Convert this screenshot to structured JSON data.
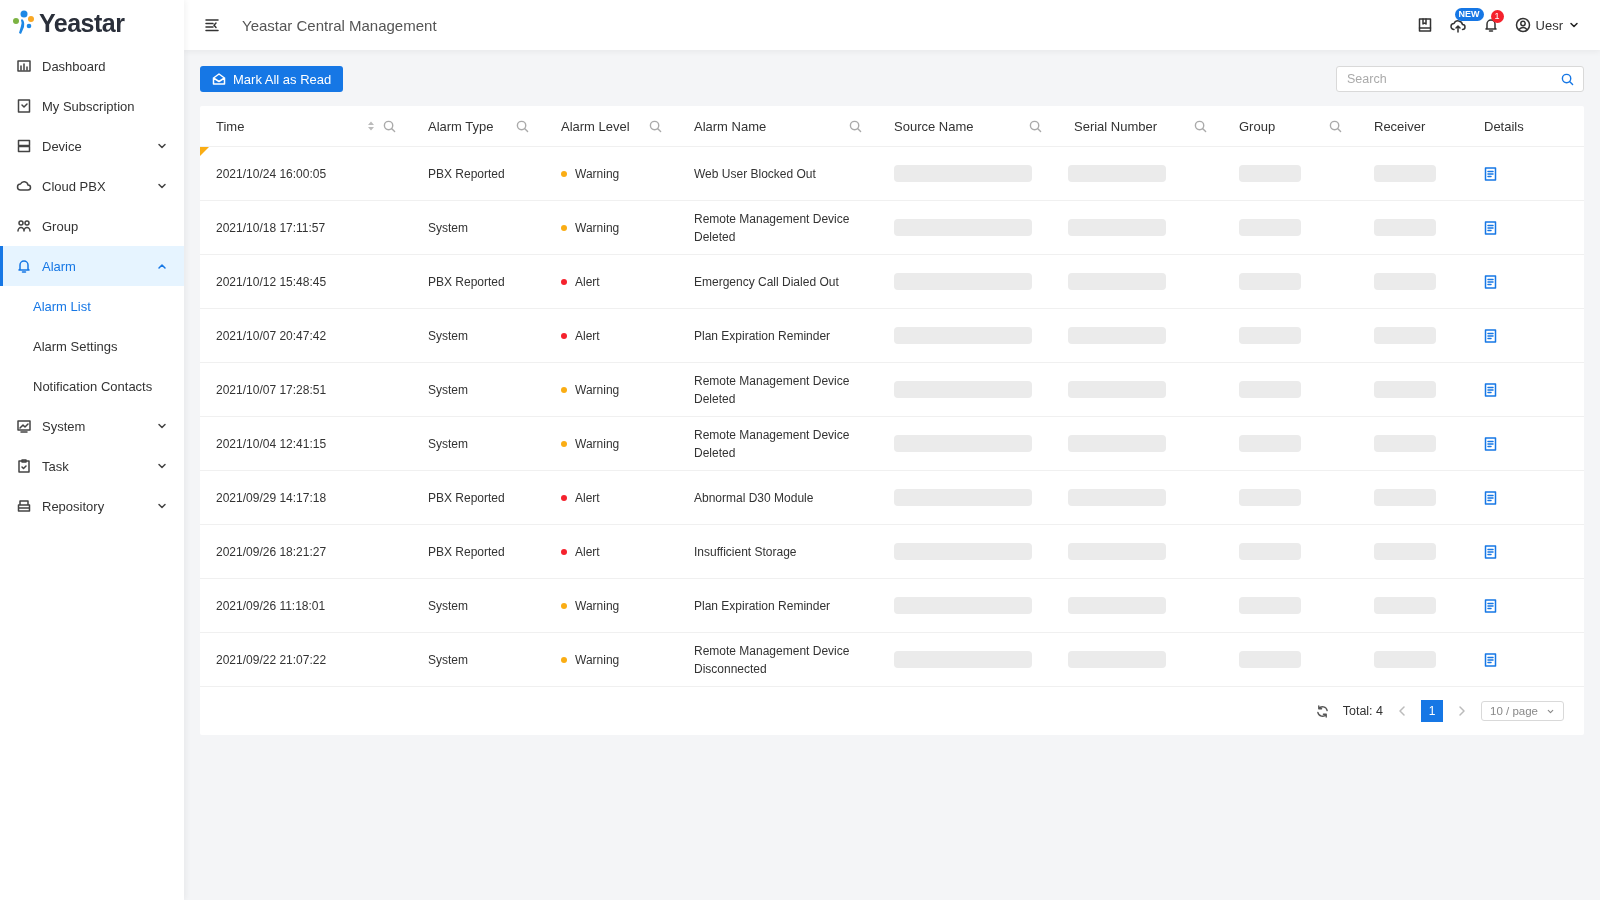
{
  "logo": {
    "text": "Yeastar"
  },
  "sidebar": {
    "items": [
      {
        "label": "Dashboard",
        "selected": false
      },
      {
        "label": "My Subscription",
        "selected": false
      },
      {
        "label": "Device",
        "selected": false,
        "expanded": false
      },
      {
        "label": "Cloud PBX",
        "selected": false,
        "expanded": false
      },
      {
        "label": "Group",
        "selected": false
      },
      {
        "label": "Alarm",
        "selected": true,
        "expanded": true,
        "children": [
          {
            "label": "Alarm List",
            "selected": true
          },
          {
            "label": "Alarm Settings",
            "selected": false
          },
          {
            "label": "Notification Contacts",
            "selected": false
          }
        ]
      },
      {
        "label": "System",
        "selected": false,
        "expanded": false
      },
      {
        "label": "Task",
        "selected": false,
        "expanded": false
      },
      {
        "label": "Repository",
        "selected": false,
        "expanded": false
      }
    ]
  },
  "header": {
    "title": "Yeastar Central Management",
    "update_badge": "NEW",
    "notification_count": "1",
    "user": "Uesr"
  },
  "toolbar": {
    "button": "Mark All as Read",
    "search": {
      "placeholder": "Search"
    }
  },
  "table": {
    "columns": [
      {
        "label": "Time",
        "sortable": true,
        "searchable": true
      },
      {
        "label": "Alarm Type",
        "sortable": false,
        "searchable": true
      },
      {
        "label": "Alarm Level",
        "sortable": false,
        "searchable": true
      },
      {
        "label": "Alarm Name",
        "sortable": false,
        "searchable": true
      },
      {
        "label": "Source Name",
        "sortable": false,
        "searchable": true
      },
      {
        "label": "Serial Number",
        "sortable": false,
        "searchable": true
      },
      {
        "label": "Group",
        "sortable": false,
        "searchable": true
      },
      {
        "label": "Receiver",
        "sortable": false,
        "searchable": false
      },
      {
        "label": "Details",
        "sortable": false,
        "searchable": false
      }
    ],
    "rows": [
      {
        "time": "2021/10/24 16:00:05",
        "type": "PBX Reported",
        "level": "Warning",
        "color": "#faad14",
        "name": "Web User Blocked Out",
        "unread": true
      },
      {
        "time": "2021/10/18 17:11:57",
        "type": "System",
        "level": "Warning",
        "color": "#faad14",
        "name": "Remote Management Device Deleted",
        "unread": false
      },
      {
        "time": "2021/10/12 15:48:45",
        "type": "PBX Reported",
        "level": "Alert",
        "color": "#f5222d",
        "name": "Emergency Call Dialed Out",
        "unread": false
      },
      {
        "time": "2021/10/07 20:47:42",
        "type": "System",
        "level": "Alert",
        "color": "#f5222d",
        "name": "Plan Expiration Reminder",
        "unread": false
      },
      {
        "time": "2021/10/07 17:28:51",
        "type": "System",
        "level": "Warning",
        "color": "#faad14",
        "name": "Remote Management Device Deleted",
        "unread": false
      },
      {
        "time": "2021/10/04 12:41:15",
        "type": "System",
        "level": "Warning",
        "color": "#faad14",
        "name": "Remote Management Device Deleted",
        "unread": false
      },
      {
        "time": "2021/09/29 14:17:18",
        "type": "PBX Reported",
        "level": "Alert",
        "color": "#f5222d",
        "name": "Abnormal D30 Module",
        "unread": false
      },
      {
        "time": "2021/09/26 18:21:27",
        "type": "PBX Reported",
        "level": "Alert",
        "color": "#f5222d",
        "name": "Insufficient Storage",
        "unread": false
      },
      {
        "time": "2021/09/26 11:18:01",
        "type": "System",
        "level": "Warning",
        "color": "#faad14",
        "name": "Plan Expiration Reminder",
        "unread": false
      },
      {
        "time": "2021/09/22 21:07:22",
        "type": "System",
        "level": "Warning",
        "color": "#faad14",
        "name": "Remote Management Device Disconnected",
        "unread": false
      }
    ]
  },
  "pagination": {
    "total": "Total: 4",
    "pages": [
      {
        "label": "1",
        "selected": true
      }
    ],
    "page_size": "10 / page"
  }
}
